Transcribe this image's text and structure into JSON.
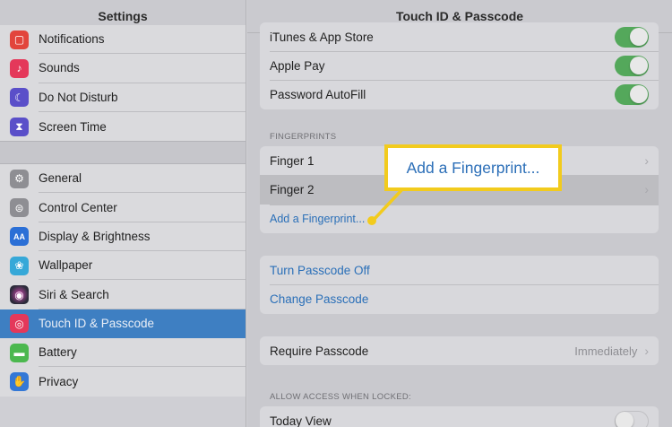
{
  "sidebar": {
    "title": "Settings",
    "group1": [
      {
        "label": "Notifications",
        "icon": "notifications-icon",
        "color": "#e2453c",
        "glyph": "▢"
      },
      {
        "label": "Sounds",
        "icon": "sounds-icon",
        "color": "#e4385a",
        "glyph": "♪"
      },
      {
        "label": "Do Not Disturb",
        "icon": "moon-icon",
        "color": "#5a4fc9",
        "glyph": "☾"
      },
      {
        "label": "Screen Time",
        "icon": "hourglass-icon",
        "color": "#5a4fc9",
        "glyph": "⧗"
      }
    ],
    "group2": [
      {
        "label": "General",
        "icon": "gear-icon",
        "color": "#8e8e93",
        "glyph": "⚙"
      },
      {
        "label": "Control Center",
        "icon": "toggles-icon",
        "color": "#8e8e93",
        "glyph": "⊜"
      },
      {
        "label": "Display & Brightness",
        "icon": "display-icon",
        "color": "#2b6fd6",
        "glyph": "AA"
      },
      {
        "label": "Wallpaper",
        "icon": "flower-icon",
        "color": "#36a8d8",
        "glyph": "❀"
      },
      {
        "label": "Siri & Search",
        "icon": "siri-icon",
        "color": "#2b2b3a",
        "glyph": "◉"
      },
      {
        "label": "Touch ID & Passcode",
        "icon": "fingerprint-icon",
        "color": "#e4385a",
        "glyph": "◎",
        "selected": true
      },
      {
        "label": "Battery",
        "icon": "battery-icon",
        "color": "#4cb84f",
        "glyph": "▬"
      },
      {
        "label": "Privacy",
        "icon": "hand-icon",
        "color": "#3478d6",
        "glyph": "✋"
      }
    ]
  },
  "main": {
    "title": "Touch ID & Passcode",
    "toggles": [
      {
        "label": "iTunes & App Store",
        "on": true
      },
      {
        "label": "Apple Pay",
        "on": true
      },
      {
        "label": "Password AutoFill",
        "on": true
      }
    ],
    "fingerprints_header": "FINGERPRINTS",
    "fingerprints": [
      "Finger 1",
      "Finger 2"
    ],
    "add_fingerprint": "Add a Fingerprint...",
    "passcode": {
      "turn_off": "Turn Passcode Off",
      "change": "Change Passcode"
    },
    "require_passcode": {
      "label": "Require Passcode",
      "value": "Immediately"
    },
    "allow_access_header": "ALLOW ACCESS WHEN LOCKED:",
    "today_view": {
      "label": "Today View",
      "on": false
    }
  },
  "callout": {
    "text": "Add a Fingerprint...",
    "border_color": "#f2cb1d"
  }
}
